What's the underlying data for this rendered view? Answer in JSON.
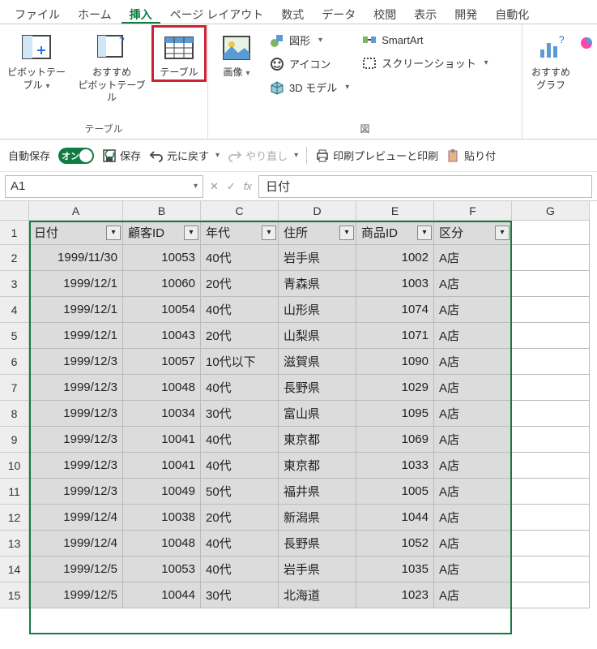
{
  "tabs": {
    "items": [
      "ファイル",
      "ホーム",
      "挿入",
      "ページ レイアウト",
      "数式",
      "データ",
      "校閲",
      "表示",
      "開発",
      "自動化"
    ],
    "active": "挿入"
  },
  "ribbon": {
    "tables": {
      "label": "テーブル",
      "pivot": "ピボットテー\nブル",
      "recpivot": "おすすめ\nピボットテーブル",
      "table": "テーブル"
    },
    "img": {
      "label": "図",
      "image": "画像",
      "shapes": "図形",
      "icons": "アイコン",
      "models": "3D モデル",
      "smartart": "SmartArt",
      "screenshot": "スクリーンショット"
    },
    "charts": {
      "rec": "おすすめ\nグラフ"
    }
  },
  "qat": {
    "autosave": "自動保存",
    "on": "オン",
    "save": "保存",
    "undo": "元に戻す",
    "redo": "やり直し",
    "printpreview": "印刷プレビューと印刷",
    "paste": "貼り付"
  },
  "fbar": {
    "name": "A1",
    "fx": "fx",
    "value": "日付"
  },
  "grid": {
    "cols": [
      "A",
      "B",
      "C",
      "D",
      "E",
      "F",
      "G"
    ],
    "headers": [
      "日付",
      "顧客ID",
      "年代",
      "住所",
      "商品ID",
      "区分"
    ],
    "rows": [
      [
        "1999/11/30",
        "10053",
        "40代",
        "岩手県",
        "1002",
        "A店"
      ],
      [
        "1999/12/1",
        "10060",
        "20代",
        "青森県",
        "1003",
        "A店"
      ],
      [
        "1999/12/1",
        "10054",
        "40代",
        "山形県",
        "1074",
        "A店"
      ],
      [
        "1999/12/1",
        "10043",
        "20代",
        "山梨県",
        "1071",
        "A店"
      ],
      [
        "1999/12/3",
        "10057",
        "10代以下",
        "滋賀県",
        "1090",
        "A店"
      ],
      [
        "1999/12/3",
        "10048",
        "40代",
        "長野県",
        "1029",
        "A店"
      ],
      [
        "1999/12/3",
        "10034",
        "30代",
        "富山県",
        "1095",
        "A店"
      ],
      [
        "1999/12/3",
        "10041",
        "40代",
        "東京都",
        "1069",
        "A店"
      ],
      [
        "1999/12/3",
        "10041",
        "40代",
        "東京都",
        "1033",
        "A店"
      ],
      [
        "1999/12/3",
        "10049",
        "50代",
        "福井県",
        "1005",
        "A店"
      ],
      [
        "1999/12/4",
        "10038",
        "20代",
        "新潟県",
        "1044",
        "A店"
      ],
      [
        "1999/12/4",
        "10048",
        "40代",
        "長野県",
        "1052",
        "A店"
      ],
      [
        "1999/12/5",
        "10053",
        "40代",
        "岩手県",
        "1035",
        "A店"
      ],
      [
        "1999/12/5",
        "10044",
        "30代",
        "北海道",
        "1023",
        "A店"
      ]
    ]
  }
}
